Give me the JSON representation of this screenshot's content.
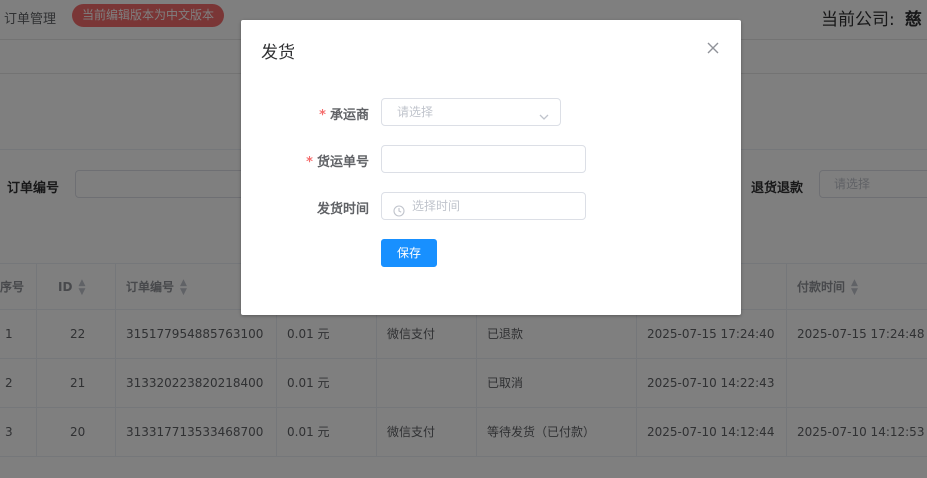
{
  "header": {
    "breadcrumb": "订单管理",
    "language_badge": "当前编辑版本为中文版本",
    "company_label": "当前公司:",
    "company_name_partial": "慈"
  },
  "search": {
    "order_no_label": "订单编号",
    "refund_label": "退货退款",
    "refund_placeholder": "请选择"
  },
  "table": {
    "columns": [
      "序号",
      "ID",
      "订单编号",
      "",
      "",
      "",
      "",
      "付款时间"
    ],
    "rows": [
      [
        "1",
        "22",
        "315177954885763100",
        "0.01 元",
        "微信支付",
        "已退款",
        "2025-07-15 17:24:40",
        "2025-07-15 17:24:48"
      ],
      [
        "2",
        "21",
        "313320223820218400",
        "0.01 元",
        "",
        "已取消",
        "2025-07-10 14:22:43",
        ""
      ],
      [
        "3",
        "20",
        "313317713533468700",
        "0.01 元",
        "微信支付",
        "等待发货（已付款）",
        "2025-07-10 14:12:44",
        "2025-07-10 14:12:53"
      ]
    ]
  },
  "dialog": {
    "title": "发货",
    "carrier_label": "承运商",
    "carrier_placeholder": "请选择",
    "tracking_label": "货运单号",
    "tracking_value": "",
    "ship_time_label": "发货时间",
    "ship_time_placeholder": "选择时间",
    "save_label": "保存",
    "required_mark": "*"
  },
  "colors": {
    "primary": "#1890ff",
    "danger": "#f56c6c",
    "mask": "rgba(0,0,0,0.5)"
  },
  "icons": {
    "close": "close-icon",
    "dropdown": "chevron-down-icon",
    "clock": "clock-icon",
    "sort": "sort-caret-icon"
  }
}
